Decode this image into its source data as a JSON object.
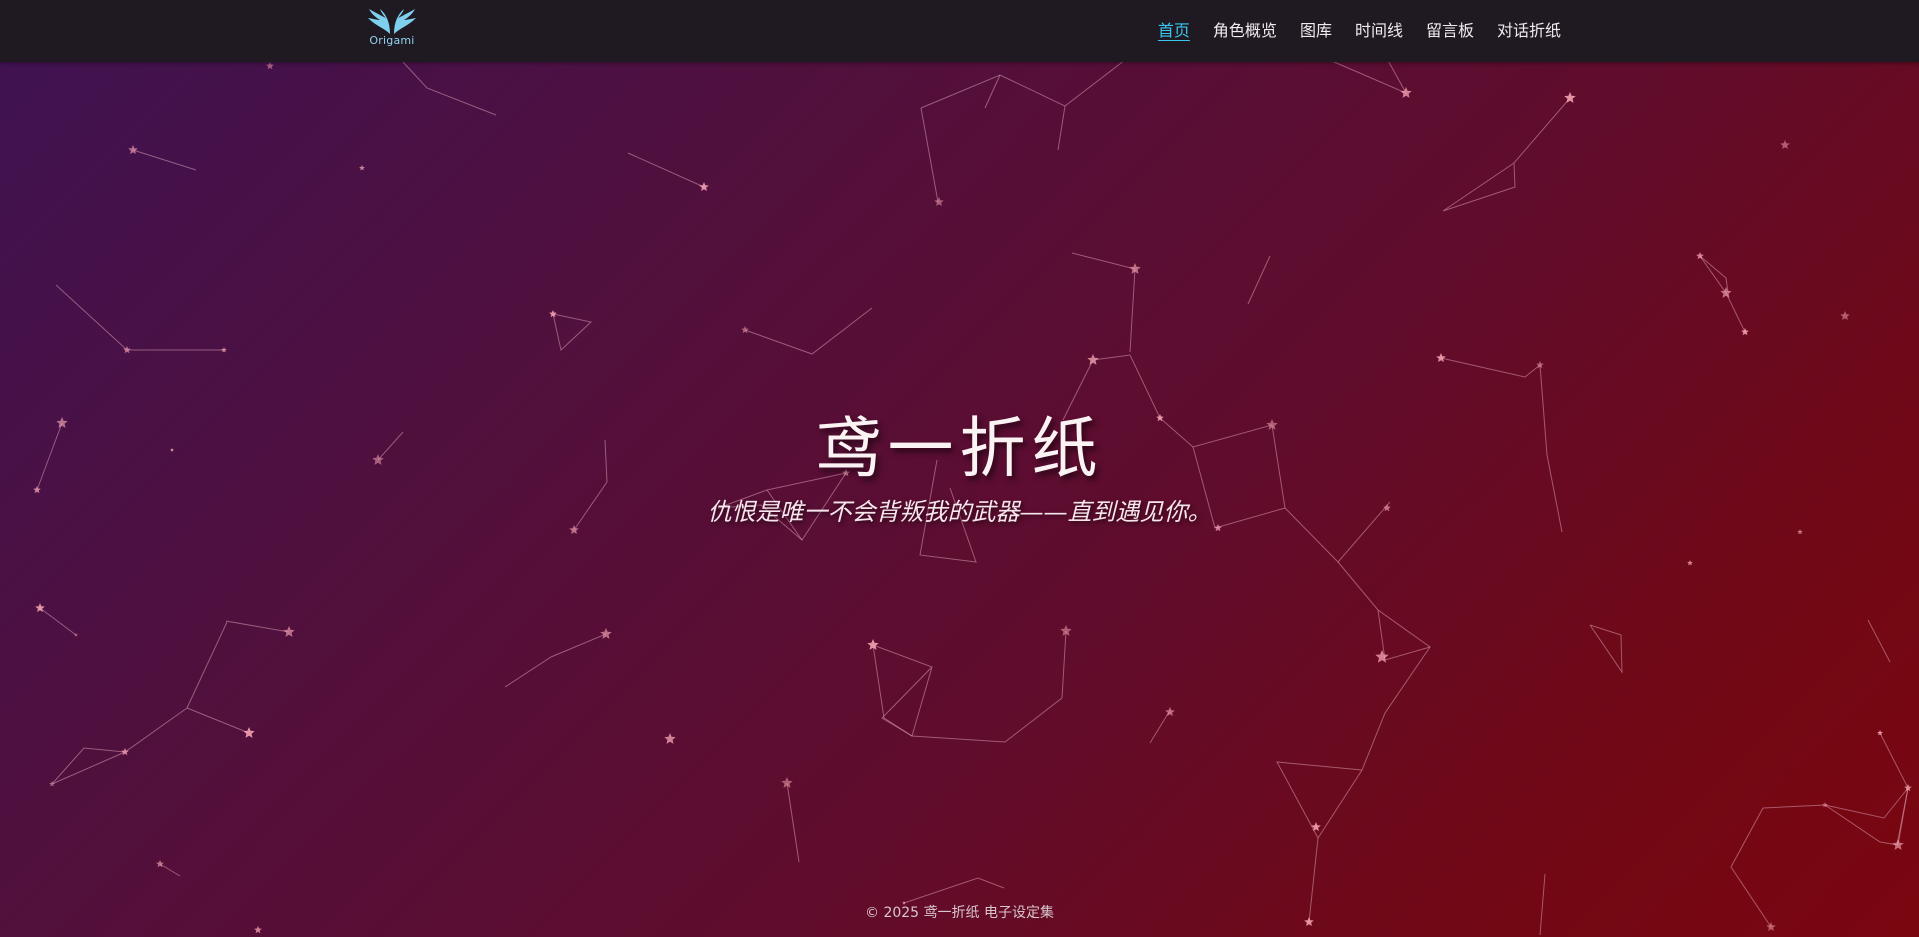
{
  "brand": {
    "logo_text": "Origami",
    "logo_icon": "wings-icon"
  },
  "nav": {
    "items": [
      {
        "label": "首页",
        "active": true
      },
      {
        "label": "角色概览",
        "active": false
      },
      {
        "label": "图库",
        "active": false
      },
      {
        "label": "时间线",
        "active": false
      },
      {
        "label": "留言板",
        "active": false
      },
      {
        "label": "对话折纸",
        "active": false
      }
    ]
  },
  "hero": {
    "title": "鸢一折纸",
    "subtitle": "仇恨是唯一不会背叛我的武器——直到遇见你。"
  },
  "footer": {
    "text": "© 2025 鸢一折纸 电子设定集"
  },
  "colors": {
    "topbar": "#1f1a22",
    "nav_active": "#39c5f0",
    "nav_text": "#f1eaf0",
    "gradient_start": "#3e1252",
    "gradient_end": "#7a0610",
    "star": "#f2a0b0",
    "line": "#d99ab0"
  }
}
